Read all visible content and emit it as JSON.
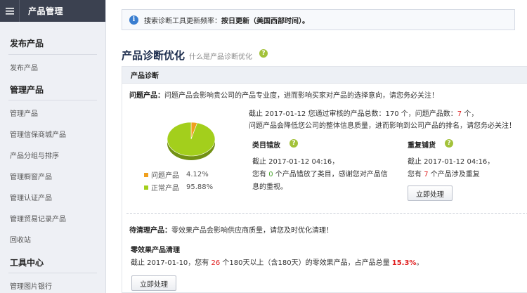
{
  "sidebar": {
    "menu_icon": "hamburger-icon",
    "title": "产品管理",
    "sections": [
      {
        "label": "发布产品",
        "items": [
          "发布产品"
        ]
      },
      {
        "label": "管理产品",
        "items": [
          "管理产品",
          "管理信保商城产品",
          "产品分组与排序",
          "管理橱窗产品",
          "管理认证产品",
          "管理贸易记录产品",
          "回收站"
        ]
      },
      {
        "label": "工具中心",
        "items": [
          "管理图片银行"
        ]
      }
    ]
  },
  "notice": {
    "icon": "info-icon",
    "prefix": "搜索诊断工具更新频率：",
    "value": "按日更新（美国西部时间）。"
  },
  "page": {
    "title": "产品诊断优化",
    "subtitle": "什么是产品诊断优化",
    "help_icon": "help-icon"
  },
  "panel": {
    "header": "产品诊断",
    "problem": {
      "label": "问题产品：",
      "desc": "问题产品会影响贵公司的产品专业度，进而影响买家对产品的选择意向，请您务必关注！",
      "summary_prefix": "截止 2017-01-12 您通过审核的产品总数：",
      "total_count": "170",
      "summary_mid": " 个，问题产品数：",
      "problem_count": "7",
      "summary_suffix": " 个，",
      "summary_line2": "问题产品会降低您公司的整体信息质量，进而影响到公司产品的排名，请您务必关注！"
    },
    "wrong_category": {
      "title": "类目错放",
      "date_line": "截止 2017-01-12 04:16，",
      "line2_prefix": "您有 ",
      "count": "0",
      "line2_suffix": " 个产品错放了类目，感谢您对产品信",
      "line3": "息的重视。"
    },
    "duplicate": {
      "title": "重复铺货",
      "date_line": "截止 2017-01-12 04:16，",
      "line2_prefix": "您有 ",
      "count": "7",
      "line2_suffix": " 个产品涉及重复",
      "button": "立即处理"
    },
    "pie": {
      "legend": [
        {
          "label": "问题产品",
          "value": "4.12%",
          "color": "#f0a01e"
        },
        {
          "label": "正常产品",
          "value": "95.88%",
          "color": "#a3cf1c"
        }
      ]
    },
    "cleanup": {
      "label": "待清理产品：",
      "desc": "零效果产品会影响供应商质量，请您及时优化清理！",
      "sub_title": "零效果产品清理",
      "line_prefix": "截止 2017-01-10，您有 ",
      "count": "26",
      "line_mid": " 个180天以上（含180天）的零效果产品，占产品总量 ",
      "percent": "15.3%",
      "line_suffix": "。",
      "button": "立即处理"
    }
  },
  "chart_data": {
    "type": "pie",
    "categories": [
      "问题产品",
      "正常产品"
    ],
    "values": [
      4.12,
      95.88
    ],
    "colors": [
      "#f0a01e",
      "#a3cf1c"
    ]
  }
}
